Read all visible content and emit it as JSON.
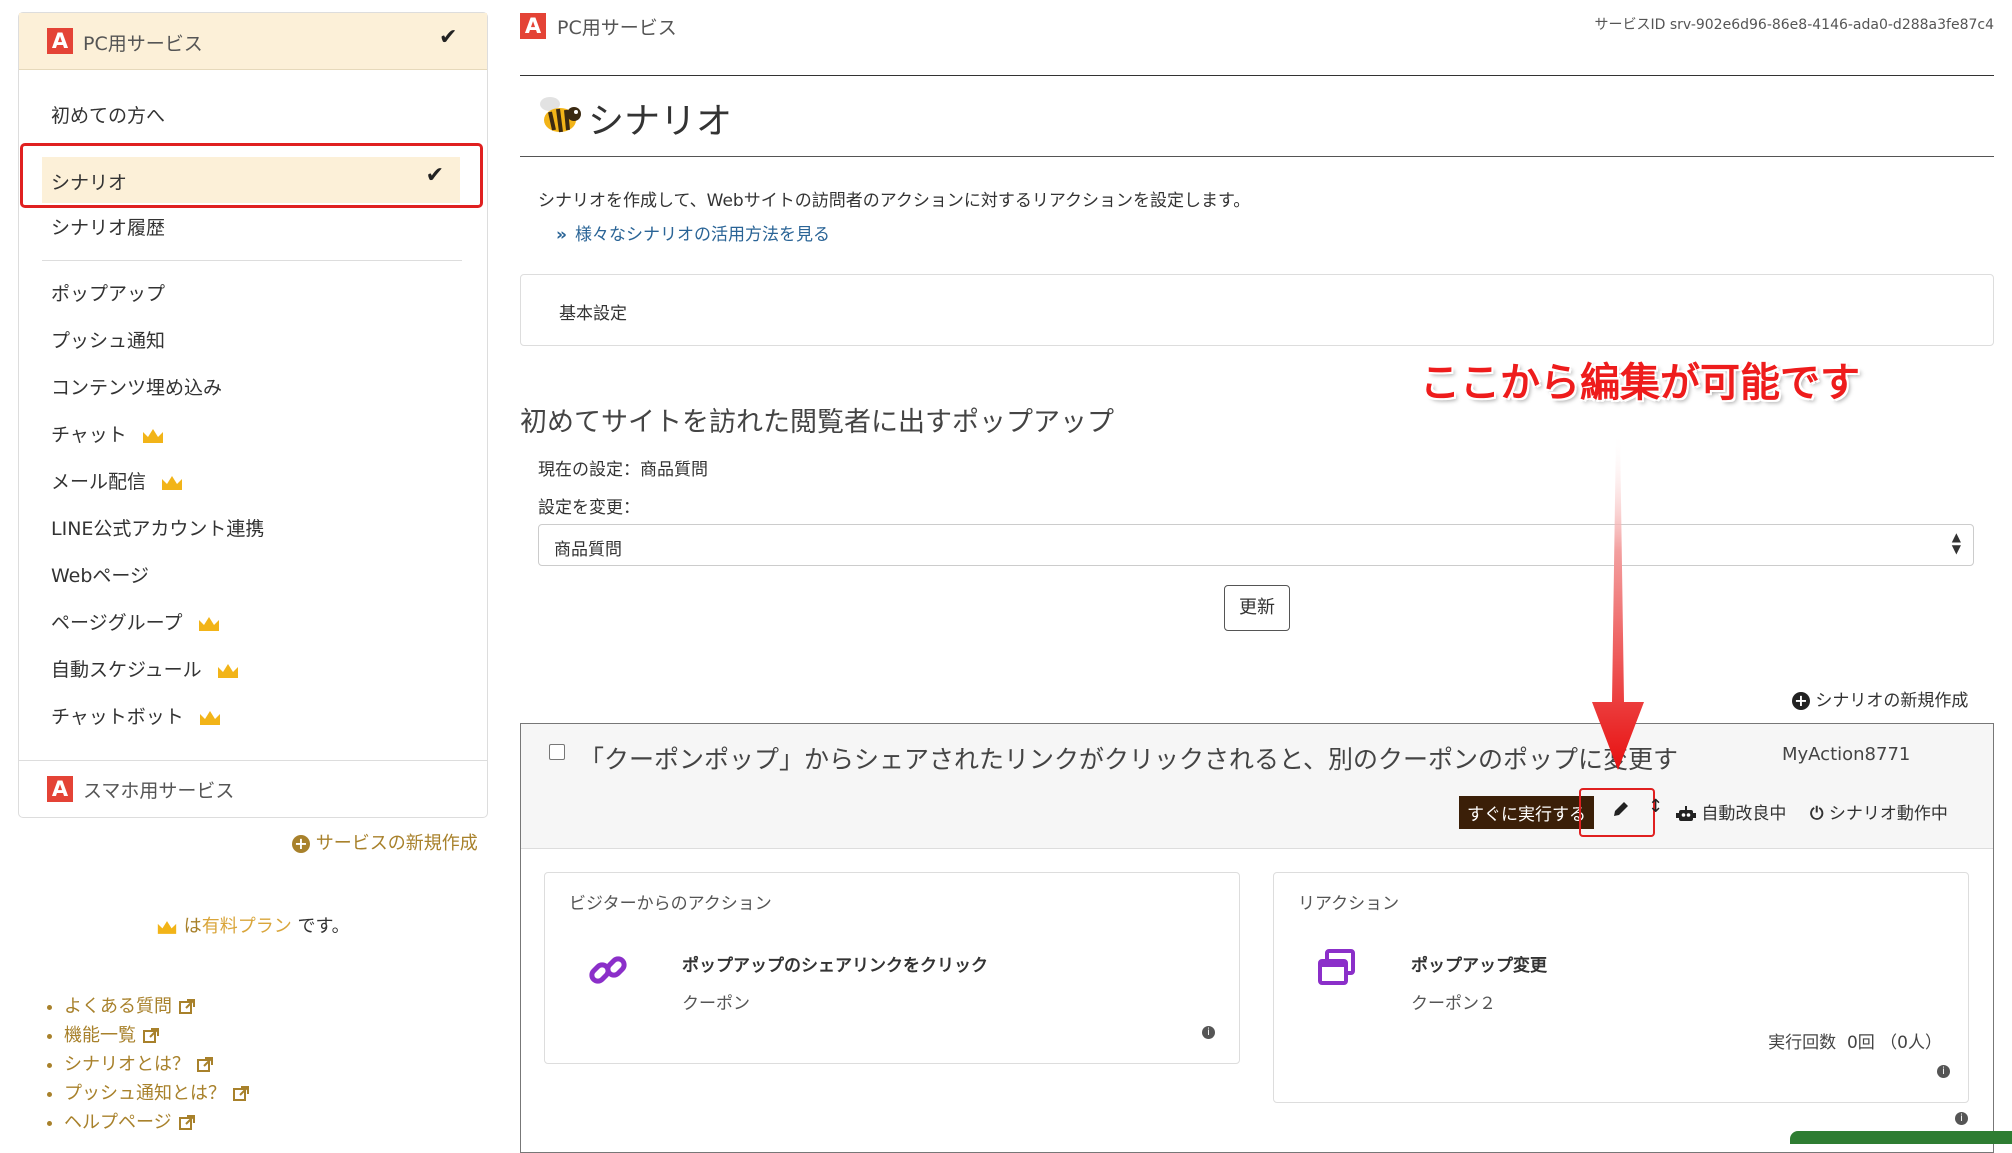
{
  "sidebar": {
    "pc_service": {
      "label": "PC用サービス",
      "logo": "A"
    },
    "nav_items": [
      {
        "label": "初めての方へ",
        "premium": false
      },
      {
        "label": "シナリオ",
        "premium": false,
        "selected": true
      },
      {
        "label": "シナリオ履歴",
        "premium": false
      },
      {
        "label": "ポップアップ",
        "premium": false
      },
      {
        "label": "プッシュ通知",
        "premium": false
      },
      {
        "label": "コンテンツ埋め込み",
        "premium": false
      },
      {
        "label": "チャット",
        "premium": true
      },
      {
        "label": "メール配信",
        "premium": true
      },
      {
        "label": "LINE公式アカウント連携",
        "premium": false
      },
      {
        "label": "Webページ",
        "premium": false
      },
      {
        "label": "ページグループ",
        "premium": true
      },
      {
        "label": "自動スケジュール",
        "premium": true
      },
      {
        "label": "チャットボット",
        "premium": true
      }
    ],
    "sp_service": {
      "label": "スマホ用サービス",
      "logo": "A"
    },
    "new_service_label": "サービスの新規作成",
    "paid_plan": {
      "prefix": "は",
      "link": "有料プラン",
      "suffix": "です。"
    },
    "help_links": [
      "よくある質問",
      "機能一覧",
      "シナリオとは？",
      "プッシュ通知とは？",
      "ヘルプページ"
    ]
  },
  "header": {
    "service_name": "PC用サービス",
    "service_id": "サービスID srv-902e6d96-86e8-4146-ada0-d288a3fe87c4"
  },
  "page": {
    "title": "シナリオ",
    "description": "シナリオを作成して、Webサイトの訪問者のアクションに対するリアクションを設定します。",
    "learn_more_link": "様々なシナリオの活用方法を見る",
    "basic_settings_label": "基本設定",
    "popup_section": {
      "heading": "初めてサイトを訪れた閲覧者に出すポップアップ",
      "current_setting": "現在の設定：商品質問",
      "change_label": "設定を変更：",
      "selected_option": "商品質問",
      "update_button": "更新"
    },
    "new_scenario_label": "シナリオの新規作成"
  },
  "scenario": {
    "title": "「クーポンポップ」からシェアされたリンクがクリックされると、別のクーポンのポップに変更す",
    "action_id": "MyAction8771",
    "run_now_label": "すぐに実行する",
    "auto_improve_label": "自動改良中",
    "status_label": "シナリオ動作中",
    "visitor_action": {
      "header": "ビジターからのアクション",
      "title": "ポップアップのシェアリンクをクリック",
      "detail": "クーポン"
    },
    "reaction": {
      "header": "リアクション",
      "title": "ポップアップ変更",
      "detail": "クーポン２",
      "execution_count": "実行回数  0回 （0人）"
    }
  },
  "annotation": {
    "text": "ここから編集が可能です"
  },
  "colors": {
    "brand_red": "#e44336",
    "gold": "#a8812b",
    "highlight": "#fcf0d8",
    "annotation_red": "#ee1c1c",
    "dark_badge": "#3b1f08",
    "link_blue": "#2a6496",
    "purple_icon": "#8b2fc9"
  }
}
